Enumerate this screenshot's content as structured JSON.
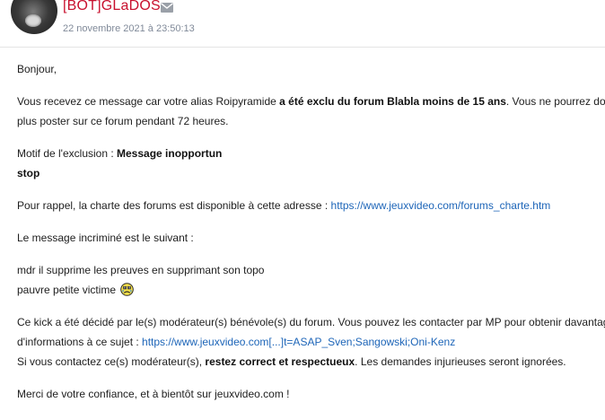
{
  "header": {
    "username": "[BOT]GLaDOS",
    "date": "22 novembre 2021 à 23:50:13"
  },
  "message": {
    "greeting": "Bonjour,",
    "p1_a": "Vous recevez ce message car votre alias Roipyramide ",
    "p1_bold": "a été exclu du forum Blabla moins de 15 ans",
    "p1_b": ". Vous ne pourrez do",
    "p1_line2": "plus poster sur ce forum pendant 72 heures.",
    "motif_label": "Motif de l'exclusion : ",
    "motif_value": "Message inopportun",
    "motif_extra": "stop",
    "charte_text": "Pour rappel, la charte des forums est disponible à cette adresse : ",
    "charte_link": "https://www.jeuxvideo.com/forums_charte.htm",
    "incrimine_intro": "Le message incriminé est le suivant :",
    "quote_line1": "mdr il supprime les preuves en supprimant son topo",
    "quote_line2": "pauvre petite victime",
    "kick_line1": "Ce kick a été décidé par le(s) modérateur(s) bénévole(s) du forum. Vous pouvez les contacter par MP pour obtenir davantag",
    "kick_line2_text": "d'informations à ce sujet : ",
    "kick_link": "https://www.jeuxvideo.com[...]t=ASAP_Sven;Sangowski;Oni-Kenz",
    "contact_a": "Si vous contactez ce(s) modérateur(s), ",
    "contact_bold": "restez correct et respectueux",
    "contact_b": ". Les demandes injurieuses seront ignorées.",
    "closing": "Merci de votre confiance, et à bientôt sur jeuxvideo.com !"
  },
  "colors": {
    "username": "#c8102e",
    "link": "#1d65b8",
    "date": "#808a99"
  }
}
